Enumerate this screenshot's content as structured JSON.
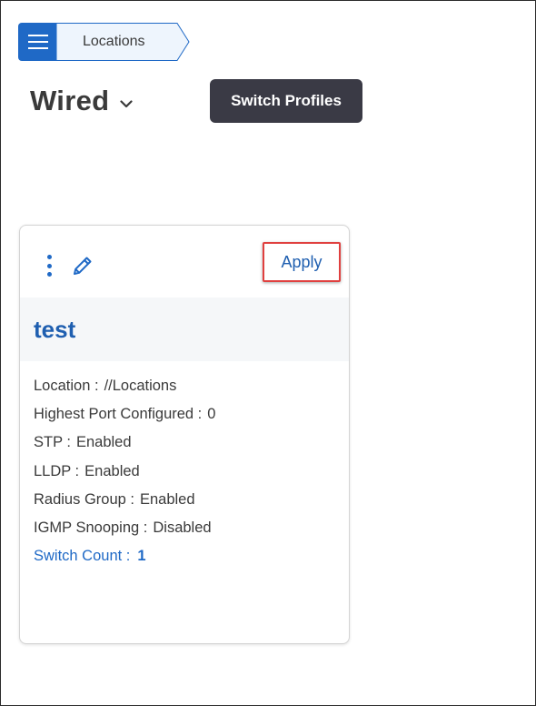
{
  "breadcrumb": {
    "item": "Locations"
  },
  "page": {
    "title": "Wired"
  },
  "tooltip": {
    "text": "Switch Profiles"
  },
  "card": {
    "apply_label": "Apply",
    "name": "test",
    "fields": [
      {
        "label": "Location :",
        "value": "//Locations"
      },
      {
        "label": "Highest Port Configured :",
        "value": "0"
      },
      {
        "label": "STP :",
        "value": "Enabled"
      },
      {
        "label": "LLDP :",
        "value": "Enabled"
      },
      {
        "label": "Radius Group :",
        "value": "Enabled"
      },
      {
        "label": "IGMP Snooping :",
        "value": "Disabled"
      }
    ],
    "switch_count": {
      "label": "Switch Count :",
      "value": "1"
    }
  },
  "colors": {
    "accent": "#1f69c6",
    "highlight_border": "#e0403f",
    "tooltip_bg": "#3a3a45"
  }
}
